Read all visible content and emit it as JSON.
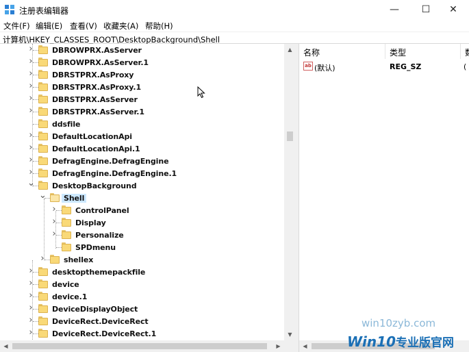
{
  "window": {
    "title": "注册表编辑器",
    "controls": {
      "minimize": "—",
      "maximize": "☐",
      "close": "✕"
    }
  },
  "menu": [
    "文件(F)",
    "编辑(E)",
    "查看(V)",
    "收藏夹(A)",
    "帮助(H)"
  ],
  "address": "计算机\\HKEY_CLASSES_ROOT\\DesktopBackground\\Shell",
  "tree": [
    {
      "label": "DBROWPRX.AsServer",
      "depth": 0,
      "expander": "collapsed"
    },
    {
      "label": "DBROWPRX.AsServer.1",
      "depth": 0,
      "expander": "collapsed"
    },
    {
      "label": "DBRSTPRX.AsProxy",
      "depth": 0,
      "expander": "collapsed"
    },
    {
      "label": "DBRSTPRX.AsProxy.1",
      "depth": 0,
      "expander": "collapsed"
    },
    {
      "label": "DBRSTPRX.AsServer",
      "depth": 0,
      "expander": "collapsed"
    },
    {
      "label": "DBRSTPRX.AsServer.1",
      "depth": 0,
      "expander": "collapsed"
    },
    {
      "label": "ddsfile",
      "depth": 0,
      "expander": "none"
    },
    {
      "label": "DefaultLocationApi",
      "depth": 0,
      "expander": "collapsed"
    },
    {
      "label": "DefaultLocationApi.1",
      "depth": 0,
      "expander": "collapsed"
    },
    {
      "label": "DefragEngine.DefragEngine",
      "depth": 0,
      "expander": "collapsed"
    },
    {
      "label": "DefragEngine.DefragEngine.1",
      "depth": 0,
      "expander": "collapsed"
    },
    {
      "label": "DesktopBackground",
      "depth": 0,
      "expander": "expanded"
    },
    {
      "label": "Shell",
      "depth": 1,
      "expander": "expanded",
      "selected": true
    },
    {
      "label": "ControlPanel",
      "depth": 2,
      "expander": "collapsed"
    },
    {
      "label": "Display",
      "depth": 2,
      "expander": "collapsed"
    },
    {
      "label": "Personalize",
      "depth": 2,
      "expander": "collapsed"
    },
    {
      "label": "SPDmenu",
      "depth": 2,
      "expander": "none"
    },
    {
      "label": "shellex",
      "depth": 1,
      "expander": "collapsed"
    },
    {
      "label": "desktopthemepackfile",
      "depth": 0,
      "expander": "collapsed"
    },
    {
      "label": "device",
      "depth": 0,
      "expander": "collapsed"
    },
    {
      "label": "device.1",
      "depth": 0,
      "expander": "collapsed"
    },
    {
      "label": "DeviceDisplayObject",
      "depth": 0,
      "expander": "collapsed"
    },
    {
      "label": "DeviceRect.DeviceRect",
      "depth": 0,
      "expander": "collapsed"
    },
    {
      "label": "DeviceRect.DeviceRect.1",
      "depth": 0,
      "expander": "collapsed"
    }
  ],
  "values_pane": {
    "columns": [
      "名称",
      "类型",
      "数"
    ],
    "rows": [
      {
        "icon": "string-value-icon",
        "icon_text": "ab",
        "name": "(默认)",
        "type": "REG_SZ",
        "data": "("
      }
    ]
  },
  "watermark": {
    "url": "win10zyb.com",
    "logo_latin": "Win10",
    "logo_chinese": "专业版官网"
  },
  "colors": {
    "selection": "#cce8ff",
    "folder": "#f9d978",
    "watermark": "#1a6fb5"
  }
}
